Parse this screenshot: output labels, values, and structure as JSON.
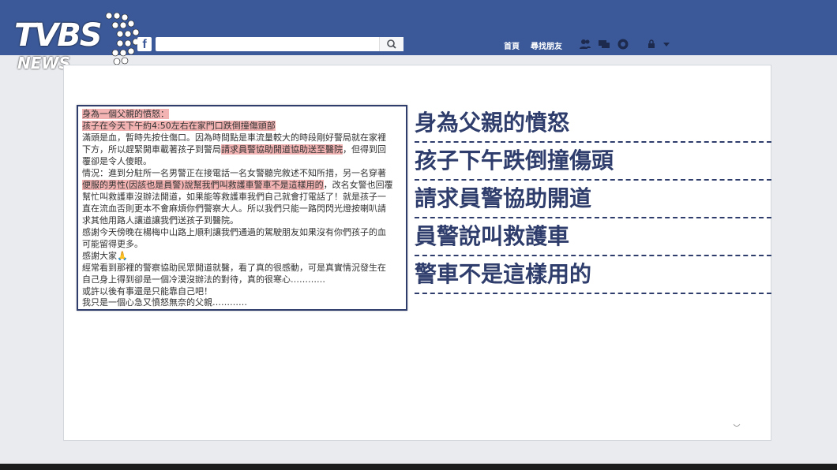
{
  "header": {
    "logo_text": "TVBS",
    "logo_sub": "NEWS",
    "fb_icon": "f",
    "search_placeholder": "",
    "nav_home": "首頁",
    "nav_find_friends": "尋找朋友",
    "icons": [
      "friends-icon",
      "messages-icon",
      "notifications-icon",
      "privacy-icon",
      "dropdown-icon"
    ]
  },
  "post": {
    "lines": [
      {
        "text": "身為一個父親的憤怒：",
        "highlight": true
      },
      {
        "text": "孩子在今天下午約4:50左右在家門口跌倒撞傷頭部",
        "highlight": true
      },
      {
        "text": "滿頭是血，暫時先按住傷口。因為時間點是車流量較大的時段剛好警局就在家裡",
        "highlight": false
      },
      {
        "text": "下方，所以趕緊開車載著孩子到警局",
        "highlight": false,
        "tail": "請求員警協助開道協助送至醫院",
        "after": "，但得到回"
      },
      {
        "text": "覆卻是令人傻眼。",
        "highlight": false
      },
      {
        "text": "情況：進到分駐所一名男警正在接電話一名女警聽完敘述不知所措，另一名穿著",
        "highlight": false
      },
      {
        "text": "便服的男性(因該也是員警)說幫我們叫救護車警車不是這樣用的",
        "highlight": true,
        "after": "，改名女警也回覆"
      },
      {
        "text": "幫忙叫救護車沒辦法開道，如果能等救護車我們自己就會打電話了！就是孩子一",
        "highlight": false
      },
      {
        "text": "直在流血否則更本不會麻煩你們警察大人。所以我們只能一路閃閃光燈按喇叭請",
        "highlight": false
      },
      {
        "text": "求其他用路人讓道讓我們送孩子到醫院。",
        "highlight": false
      },
      {
        "text": "感謝今天傍晚在楊梅中山路上順利讓我們通過的駕駛朋友如果沒有你們孩子的血",
        "highlight": false
      },
      {
        "text": "可能留得更多。",
        "highlight": false
      },
      {
        "text": "感謝大家🙏",
        "highlight": false
      },
      {
        "text": "經常看到那裡的警察協助民眾開道就醫，看了真的很感動，可是真實情況發生在",
        "highlight": false
      },
      {
        "text": "自己身上得到卻是一個冷漠沒辦法的對待，真的很寒心…………",
        "highlight": false
      },
      {
        "text": "或許以後有事還是只能靠自己吧！",
        "highlight": false
      },
      {
        "text": "我只是一個心急又憤怒無奈的父親…………",
        "highlight": false
      }
    ]
  },
  "callouts": [
    "身為父親的憤怒",
    "孩子下午跌倒撞傷頭",
    "請求員警協助開道",
    "員警說叫救護車",
    "警車不是這樣用的"
  ],
  "colors": {
    "fb_blue": "#3b5998",
    "callout_navy": "#2e3d6b",
    "highlight_pink": "#f3b3b3"
  }
}
